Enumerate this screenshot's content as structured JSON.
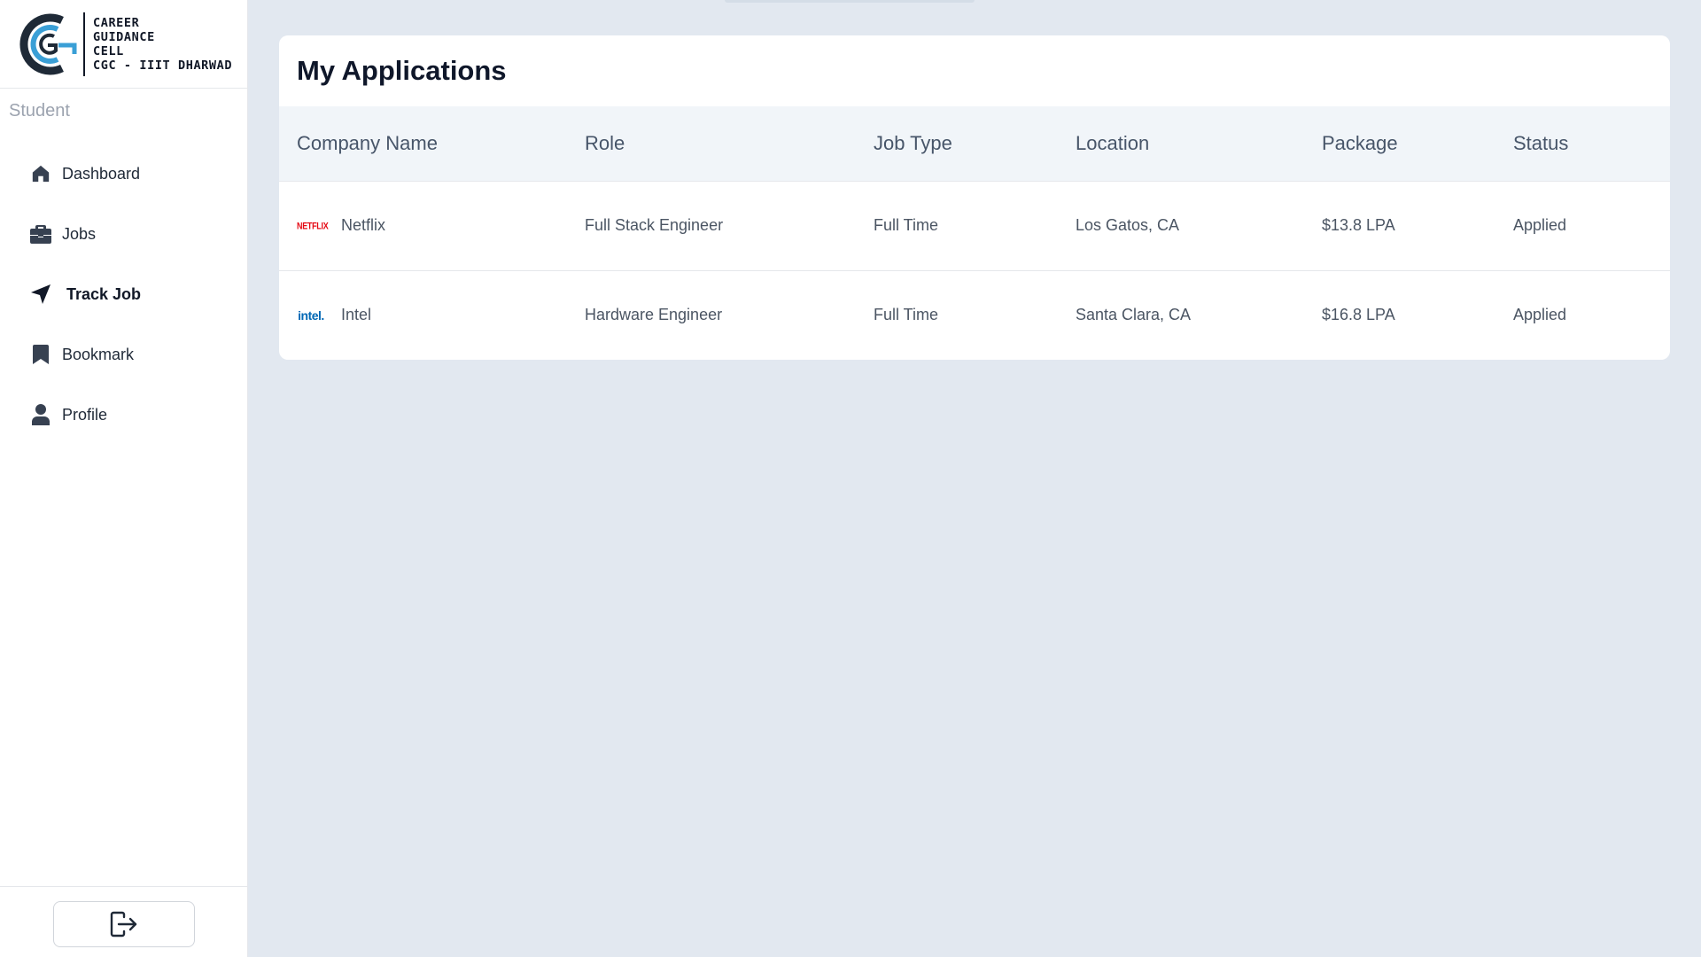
{
  "brand": {
    "lines": [
      "CAREER",
      "GUIDANCE",
      "CELL",
      "CGC - IIIT DHARWAD"
    ],
    "colors": {
      "dark": "#1f2a37",
      "accent": "#3a9fd6"
    }
  },
  "sidebar": {
    "section_label": "Student",
    "items": [
      {
        "label": "Dashboard",
        "icon": "home-icon",
        "active": false
      },
      {
        "label": "Jobs",
        "icon": "briefcase-icon",
        "active": false
      },
      {
        "label": "Track Job",
        "icon": "location-arrow-icon",
        "active": true
      },
      {
        "label": "Bookmark",
        "icon": "bookmark-icon",
        "active": false
      },
      {
        "label": "Profile",
        "icon": "user-icon",
        "active": false
      }
    ],
    "logout_icon": "logout-icon"
  },
  "main": {
    "title": "My Applications",
    "columns": [
      "Company Name",
      "Role",
      "Job Type",
      "Location",
      "Package",
      "Status"
    ],
    "rows": [
      {
        "logo": "NETFLIX",
        "logo_color": "#e50914",
        "company": "Netflix",
        "role": "Full Stack Engineer",
        "job_type": "Full Time",
        "location": "Los Gatos, CA",
        "package": "$13.8 LPA",
        "status": "Applied"
      },
      {
        "logo": "intel.",
        "logo_color": "#0068b5",
        "company": "Intel",
        "role": "Hardware Engineer",
        "job_type": "Full Time",
        "location": "Santa Clara, CA",
        "package": "$16.8 LPA",
        "status": "Applied"
      }
    ]
  }
}
